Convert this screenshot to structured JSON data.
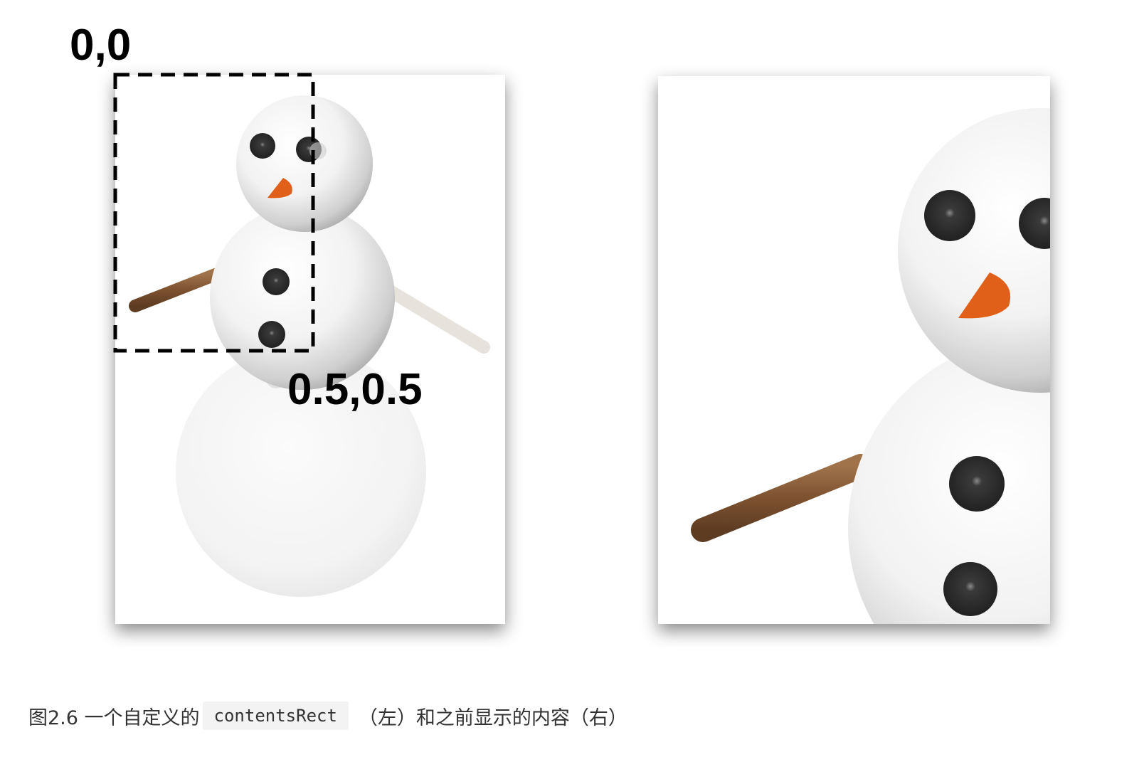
{
  "labels": {
    "origin": "0,0",
    "corner": "0.5,0.5"
  },
  "caption": {
    "prefix": "图2.6 一个自定义的",
    "code": "contentsRect",
    "suffix": "（左）和之前显示的内容（右）"
  },
  "colors": {
    "stick": "#8a5a35",
    "carrot": "#e0601a",
    "button": "#2b2b2b",
    "dash": "#000000"
  }
}
